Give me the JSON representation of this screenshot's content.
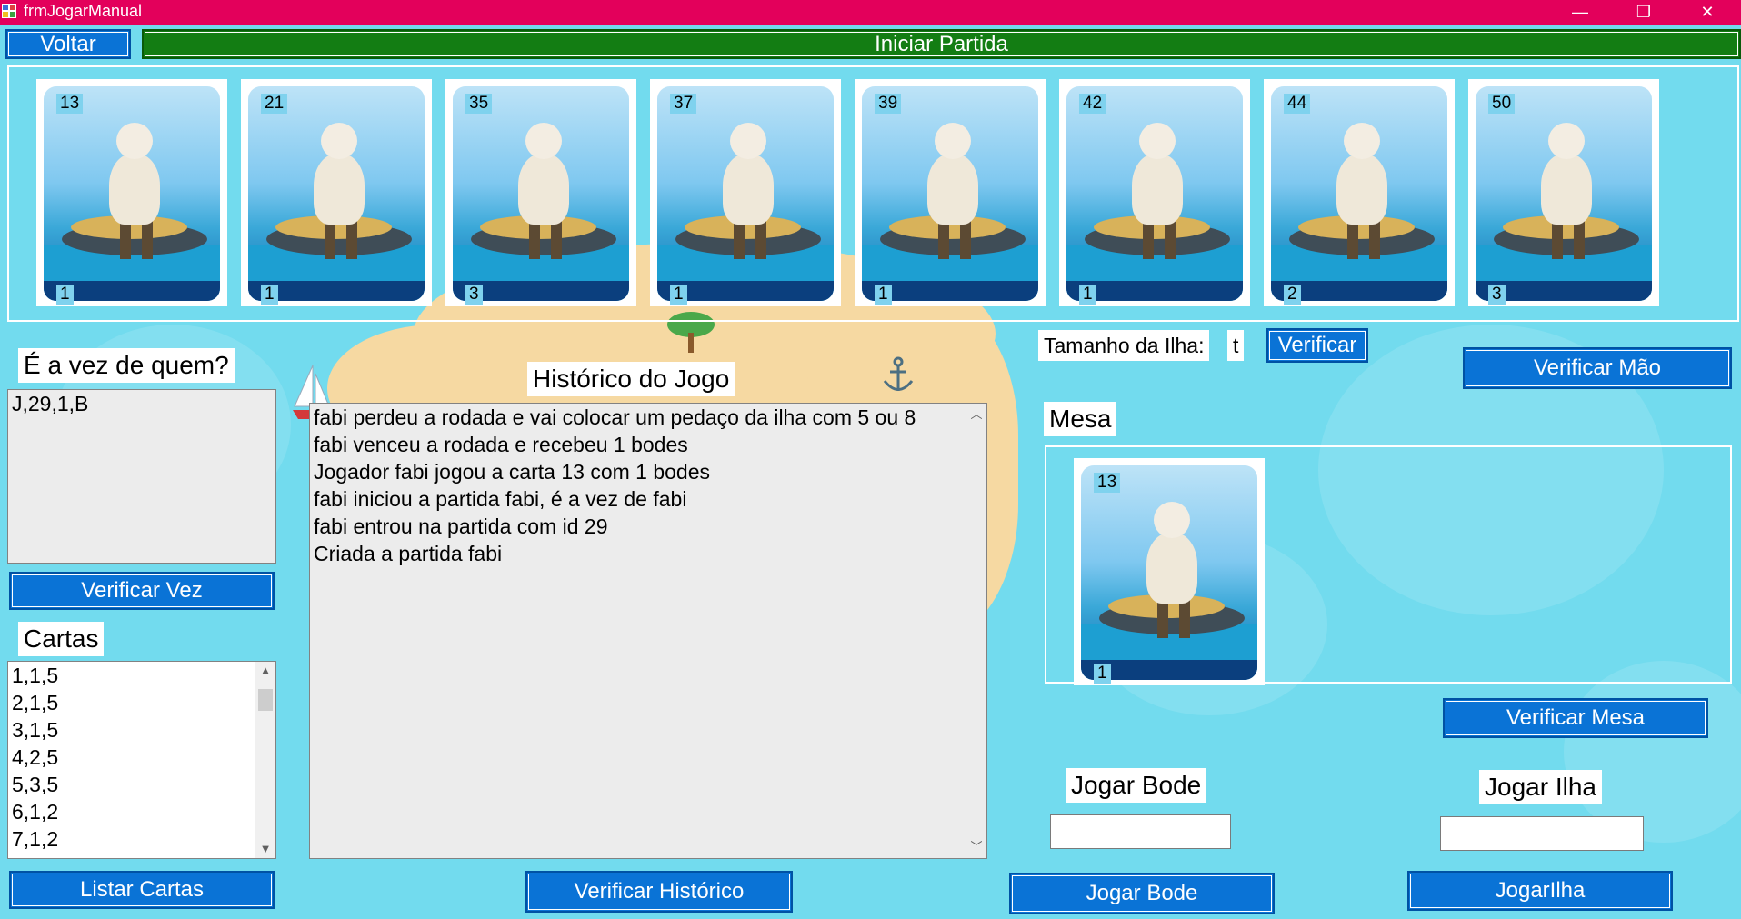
{
  "window": {
    "title": "frmJogarManual",
    "minimize": "—",
    "restore": "❐",
    "close": "✕"
  },
  "toolbar": {
    "back_label": "Voltar",
    "start_label": "Iniciar Partida"
  },
  "hand": [
    {
      "number": "13",
      "count": "1"
    },
    {
      "number": "21",
      "count": "1"
    },
    {
      "number": "35",
      "count": "3"
    },
    {
      "number": "37",
      "count": "1"
    },
    {
      "number": "39",
      "count": "1"
    },
    {
      "number": "42",
      "count": "1"
    },
    {
      "number": "44",
      "count": "2"
    },
    {
      "number": "50",
      "count": "3"
    }
  ],
  "turn": {
    "label": "É a vez de quem?",
    "value": "J,29,1,B",
    "button": "Verificar Vez"
  },
  "cards_list": {
    "label": "Cartas",
    "items": [
      "1,1,5",
      "2,1,5",
      "3,1,5",
      "4,2,5",
      "5,3,5",
      "6,1,2",
      "7,1,2"
    ],
    "button": "Listar Cartas"
  },
  "history": {
    "label": "Histórico do Jogo",
    "lines": [
      "fabi perdeu a rodada e vai colocar um pedaço da ilha com 5 ou 8",
      "fabi venceu a rodada e recebeu 1 bodes",
      "Jogador fabi jogou a carta 13 com 1 bodes",
      "fabi iniciou a partida fabi, é a vez de fabi",
      "fabi entrou na partida com id 29",
      "Criada a partida fabi"
    ],
    "button": "Verificar Histórico"
  },
  "island": {
    "label": "Tamanho da Ilha:",
    "value": "t",
    "button": "Verificar"
  },
  "hand_check_button": "Verificar Mão",
  "table": {
    "label": "Mesa",
    "card": {
      "number": "13",
      "count": "1"
    },
    "button": "Verificar Mesa"
  },
  "play_goat": {
    "label": "Jogar Bode",
    "value": "",
    "button": "Jogar Bode"
  },
  "play_island": {
    "label": "Jogar Ilha",
    "value": "",
    "button": "JogarIlha"
  }
}
